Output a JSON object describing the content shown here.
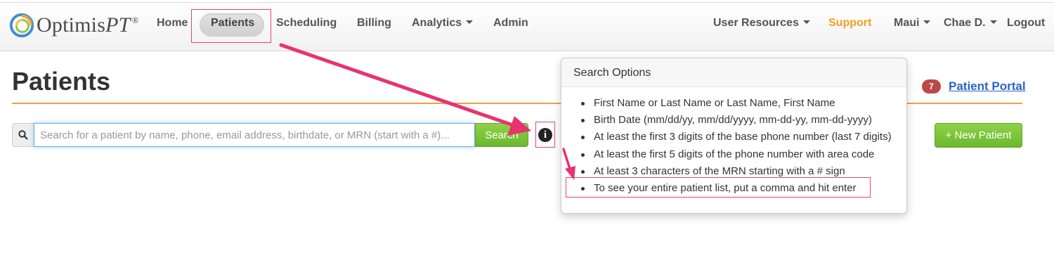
{
  "app": {
    "logo_name": "Optimis",
    "logo_italic": "PT",
    "logo_reg": "®"
  },
  "nav": {
    "home": "Home",
    "patients": "Patients",
    "scheduling": "Scheduling",
    "billing": "Billing",
    "analytics": "Analytics",
    "admin": "Admin",
    "user_resources": "User Resources",
    "support": "Support",
    "location": "Maui",
    "user": "Chae D.",
    "logout": "Logout"
  },
  "page": {
    "title": "Patients",
    "portal_badge": "7",
    "portal_link": "Patient Portal"
  },
  "search": {
    "placeholder": "Search for a patient by name, phone, email address, birthdate, or MRN (start with a #)...",
    "button": "Search",
    "info_glyph": "i",
    "new_patient": "+ New Patient"
  },
  "popover": {
    "title": "Search Options",
    "items": [
      "First Name or Last Name or Last Name, First Name",
      "Birth Date (mm/dd/yy, mm/dd/yyyy, mm-dd-yy, mm-dd-yyyy)",
      "At least the first 3 digits of the base phone number (last 7 digits)",
      "At least the first 5 digits of the phone number with area code",
      "At least 3 characters of the MRN starting with a # sign",
      "To see your entire patient list, put a comma and hit enter"
    ]
  },
  "colors": {
    "accent_orange": "#f0a040",
    "support": "#f0a020",
    "link_blue": "#2a63c8",
    "button_green": "#7cc43a",
    "badge_red": "#b94a48",
    "annotation_pink": "#e0457b"
  }
}
